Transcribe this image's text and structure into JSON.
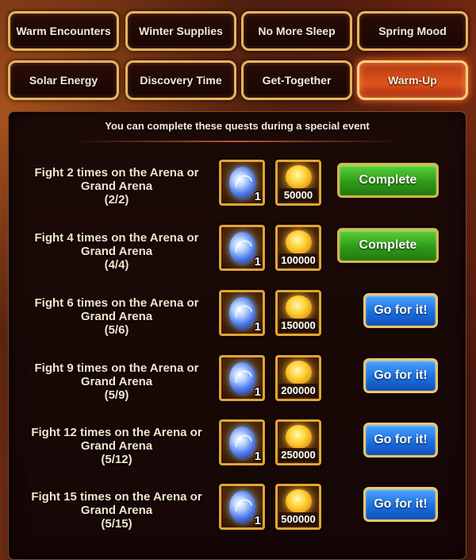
{
  "tabs": [
    {
      "label": "Warm Encounters",
      "active": false
    },
    {
      "label": "Winter Supplies",
      "active": false
    },
    {
      "label": "No More Sleep",
      "active": false
    },
    {
      "label": "Spring Mood",
      "active": false
    },
    {
      "label": "Solar Energy",
      "active": false
    },
    {
      "label": "Discovery Time",
      "active": false
    },
    {
      "label": "Get-Together",
      "active": false
    },
    {
      "label": "Warm-Up",
      "active": true
    }
  ],
  "panel": {
    "event_note": "You can complete these quests during a special event"
  },
  "quests": [
    {
      "text": "Fight 2 times on the Arena or Grand Arena",
      "progress": "(2/2)",
      "orb_qty": "1",
      "gold": "50000",
      "button": "Complete",
      "state": "complete"
    },
    {
      "text": "Fight 4 times on the Arena or Grand Arena",
      "progress": "(4/4)",
      "orb_qty": "1",
      "gold": "100000",
      "button": "Complete",
      "state": "complete"
    },
    {
      "text": "Fight 6 times on the Arena or Grand Arena",
      "progress": "(5/6)",
      "orb_qty": "1",
      "gold": "150000",
      "button": "Go for it!",
      "state": "go"
    },
    {
      "text": "Fight 9 times on the Arena or Grand Arena",
      "progress": "(5/9)",
      "orb_qty": "1",
      "gold": "200000",
      "button": "Go for it!",
      "state": "go"
    },
    {
      "text": "Fight 12 times on the Arena or Grand Arena",
      "progress": "(5/12)",
      "orb_qty": "1",
      "gold": "250000",
      "button": "Go for it!",
      "state": "go"
    },
    {
      "text": "Fight 15 times on the Arena or Grand Arena",
      "progress": "(5/15)",
      "orb_qty": "1",
      "gold": "500000",
      "button": "Go for it!",
      "state": "go"
    }
  ],
  "icons": {
    "reward_1": "blue-orb-icon",
    "reward_2": "gold-coin-icon"
  },
  "colors": {
    "active_tab": "#e0531c",
    "complete_button": "#2f9b18",
    "go_button": "#1c6fe0",
    "frame_gold": "#e3a531"
  }
}
